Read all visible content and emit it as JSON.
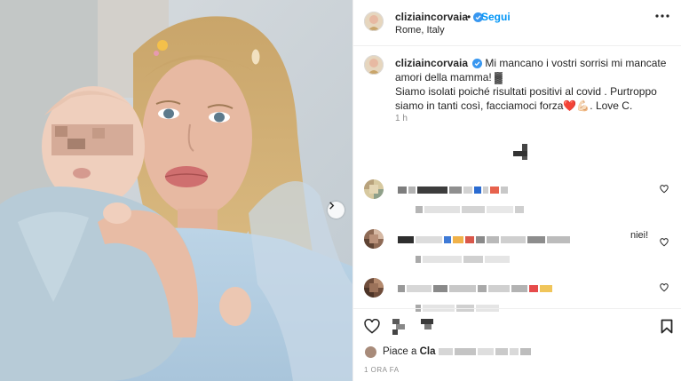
{
  "post": {
    "username": "cliziaincorvaia",
    "follow_label": "Segui",
    "separator": "•",
    "location": "Rome, Italy",
    "caption": {
      "username": "cliziaincorvaia",
      "line1": "Mi mancano i vostri sorrisi mi mancate amori della mamma! ▓",
      "line2": "Siamo isolati poiché risultati positivi al covid . Purtroppo siamo in tanti così, facciamoci forza❤️💪🏻. Love C.",
      "time": "1 h"
    },
    "comments": [
      {
        "tail": ""
      },
      {
        "tail": "niei!"
      },
      {
        "tail": ""
      }
    ],
    "likes": {
      "prefix": "Piace a",
      "name": "Cla"
    },
    "posted": "1 ORA FA"
  },
  "icons": {
    "verified": "verified-badge-icon",
    "more": "more-options-icon",
    "next": "chevron-right-icon",
    "like": "heart-icon",
    "comment": "comment-icon",
    "share": "share-icon",
    "save": "bookmark-icon"
  },
  "colors": {
    "accent": "#0095f6",
    "text": "#262626",
    "muted": "#8e8e8e",
    "border": "#efefef"
  }
}
